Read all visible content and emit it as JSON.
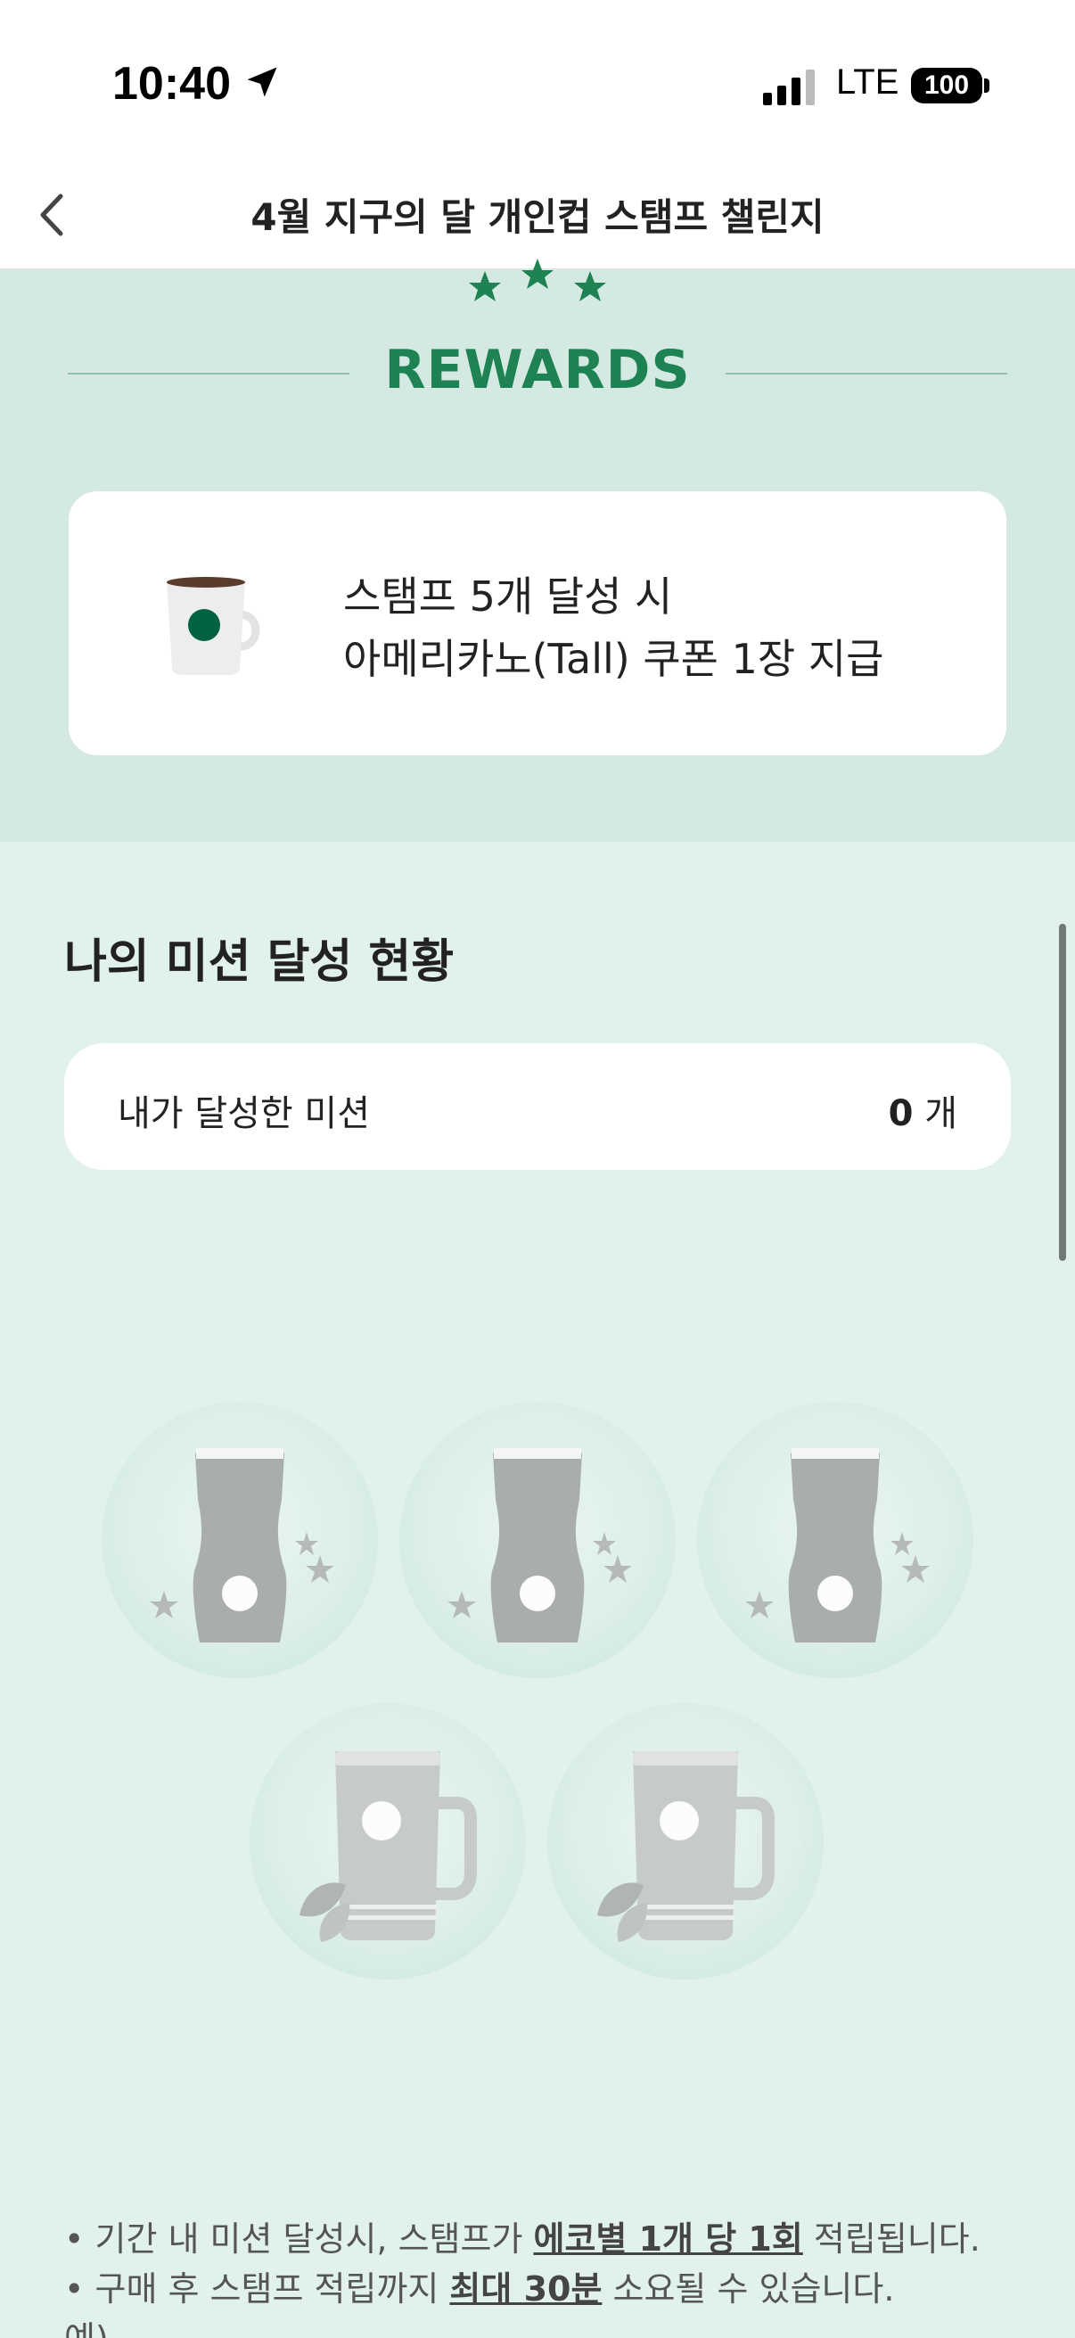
{
  "status_bar": {
    "time": "10:40",
    "network": "LTE",
    "battery": "100"
  },
  "header": {
    "title": "4월 지구의 달 개인컵 스탬프 챌린지"
  },
  "rewards": {
    "heading": "REWARDS",
    "line1": "스탬프 5개 달성 시",
    "line2": "아메리카노(Tall) 쿠폰 1장 지급"
  },
  "mission": {
    "section_title": "나의 미션 달성 현황",
    "label": "내가 달성한 미션",
    "count": "0",
    "unit": "개"
  },
  "stamps": [
    {
      "type": "tumbler",
      "achieved": false
    },
    {
      "type": "tumbler",
      "achieved": false
    },
    {
      "type": "tumbler",
      "achieved": false
    },
    {
      "type": "mug",
      "achieved": false
    },
    {
      "type": "mug",
      "achieved": false
    }
  ],
  "notes": {
    "n1_pre": "• 기간 내 미션 달성시, 스탬프가 ",
    "n1_bold": "에코별 1개 당 1회",
    "n1_post": " 적립됩니다.",
    "n2_pre": "• 구매 후 스탬프 적립까지 ",
    "n2_bold": "최대 30분",
    "n2_post": " 소요될 수 있습니다.",
    "n3": "예)"
  },
  "colors": {
    "brand_green": "#1e8253",
    "band_bg": "#d4e9e2",
    "page_bg": "#e1f1ec"
  },
  "icons": [
    "location-arrow-icon",
    "signal-icon",
    "battery-icon",
    "back-chevron-icon",
    "stars-icon",
    "coffee-cup-icon",
    "tumbler-icon",
    "mug-icon"
  ]
}
